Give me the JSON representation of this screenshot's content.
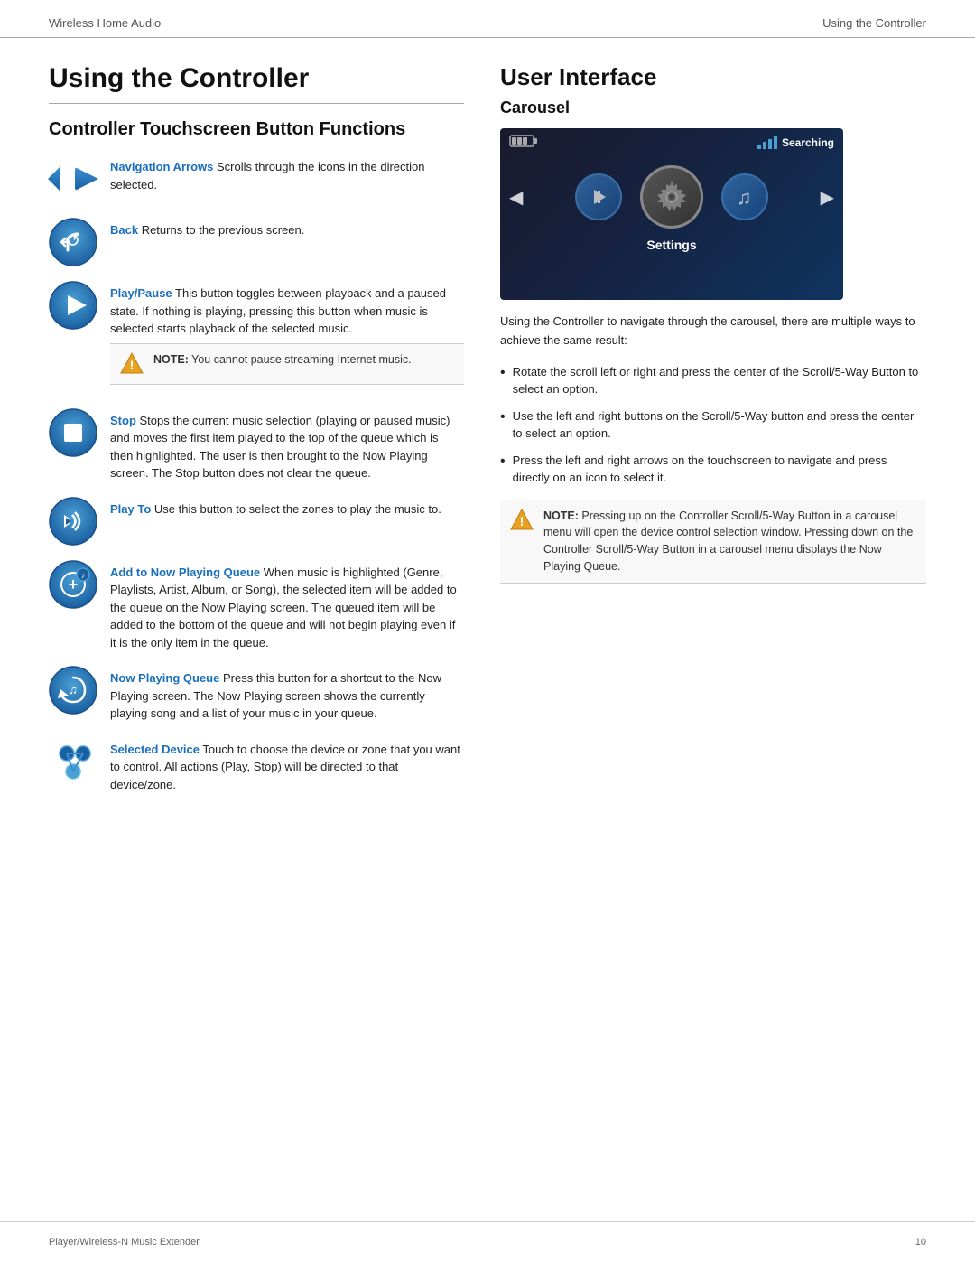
{
  "header": {
    "left": "Wireless Home Audio",
    "right": "Using the Controller"
  },
  "main_title": "Using the Controller",
  "left_section_title": "Controller Touchscreen Button Functions",
  "buttons": [
    {
      "id": "navigation-arrows",
      "label": "Navigation Arrows",
      "description": " Scrolls through the icons in the direction selected.",
      "icon_type": "nav-arrows"
    },
    {
      "id": "back",
      "label": "Back",
      "description": "  Returns to the previous screen.",
      "icon_type": "back"
    },
    {
      "id": "play-pause",
      "label": "Play/Pause",
      "description": " This button toggles between playback and a paused state. If nothing is playing, pressing this button when music is selected starts playback of the selected music.",
      "icon_type": "play",
      "note": "You cannot pause streaming Internet music."
    },
    {
      "id": "stop",
      "label": "Stop",
      "description": "  Stops the current music selection (playing or paused music) and moves the first item played to the top of the queue which is then highlighted. The user is then brought to the Now Playing screen. The Stop button does not clear the queue.",
      "icon_type": "stop"
    },
    {
      "id": "play-to",
      "label": "Play To",
      "description": "  Use this button to select the zones to play the music to.",
      "icon_type": "play-to"
    },
    {
      "id": "add-to-queue",
      "label": "Add to Now Playing Queue",
      "description": "  When music is highlighted (Genre, Playlists, Artist, Album, or Song), the selected item will be added to the queue on the Now Playing screen. The queued item will be added to the bottom of the queue and will not begin playing even if it is the only item in the queue.",
      "icon_type": "add-queue"
    },
    {
      "id": "now-playing-queue",
      "label": "Now Playing Queue",
      "description": "  Press this button for a shortcut to the Now Playing screen. The Now Playing screen shows the currently playing song and a list of your music in your queue.",
      "icon_type": "now-playing"
    },
    {
      "id": "selected-device",
      "label": "Selected Device",
      "description": "  Touch to choose the device or zone that you want to control. All actions (Play, Stop) will be directed to that device/zone.",
      "icon_type": "selected-device"
    }
  ],
  "right_section": {
    "title": "User Interface",
    "carousel_subtitle": "Carousel",
    "carousel_label": "Settings",
    "carousel_signal": "Searching",
    "carousel_desc": "Using the Controller to navigate through the carousel, there are multiple ways to achieve the same result:",
    "bullets": [
      "Rotate the scroll left or right and press the center of the Scroll/5-Way Button to select an option.",
      "Use the left and right buttons on the Scroll/5-Way button and press the center to select an option.",
      "Press the left and right arrows on the touchscreen to navigate and press directly on an icon to select it."
    ],
    "note": "Pressing up on the Controller Scroll/5-Way Button in a carousel menu will open the device control selection window. Pressing down on the Controller Scroll/5-Way Button in a carousel menu displays the Now Playing Queue."
  },
  "footer": {
    "left": "Player/Wireless-N Music Extender",
    "right": "10"
  }
}
